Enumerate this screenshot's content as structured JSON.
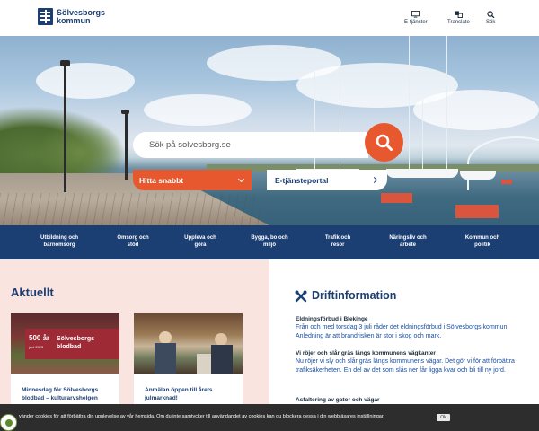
{
  "header": {
    "logo_line1": "Sölvesborgs",
    "logo_line2": "kommun",
    "eservices_label": "E-tjänster",
    "translate_label": "Translate",
    "search_label": "Sök",
    "eservices_icon": "monitor-icon",
    "translate_icon": "translate-icon",
    "search_icon": "search-icon"
  },
  "hero": {
    "search_placeholder": "Sök på solvesborg.se",
    "quick_label": "Hitta snabbt",
    "eportal_label": "E-tjänsteportal"
  },
  "nav": {
    "items": [
      {
        "line1": "Utbildning och",
        "line2": "barnomsorg"
      },
      {
        "line1": "Omsorg och",
        "line2": "stöd"
      },
      {
        "line1": "Uppleva och",
        "line2": "göra"
      },
      {
        "line1": "Bygga, bo och",
        "line2": "miljö"
      },
      {
        "line1": "Trafik och",
        "line2": "resor"
      },
      {
        "line1": "Näringsliv och",
        "line2": "arbete"
      },
      {
        "line1": "Kommun och",
        "line2": "politik"
      }
    ]
  },
  "news": {
    "title": "Aktuellt",
    "cards": [
      {
        "title": "Minnesdag för Sölvesborgs blodbad – kulturarvshelgen",
        "badge_year": "500 år",
        "badge_date": "juni 2025",
        "badge_name_line1": "Sölvesborgs",
        "badge_name_line2": "blodbad"
      },
      {
        "title": "Anmälan öppen till årets julmarknad!"
      }
    ]
  },
  "drift": {
    "title": "Driftinformation",
    "items": [
      {
        "heading": "Eldningsförbud i Blekinge",
        "text": "Från och med torsdag 3 juli råder det eldningsförbud i Sölvesborgs kommun. Anledning är att brandrisken är stor i skog och mark."
      },
      {
        "heading": "Vi röjer och slår gräs längs kommunens vägkanter",
        "text": "Nu röjer vi sly och slår gräs längs kommunens vägar. Det gör vi för att förbättra trafiksäkerheten. En del av det som slås ner får ligga kvar och bli till ny jord."
      },
      {
        "heading": "Asfaltering av gator och vägar",
        "text": ""
      }
    ]
  },
  "cookie": {
    "text": "vänder cookies för att förbättra din upplevelse av vår hemsida. Om du inte samtycker till användandet av cookies kan du blockera dessa i din webbläsares inställningar.",
    "ok_label": "Ok"
  },
  "colors": {
    "brand_navy": "#1c3f73",
    "accent_orange": "#e8582e",
    "news_bg": "#f9e4df",
    "badge_red": "#9e2a35"
  }
}
